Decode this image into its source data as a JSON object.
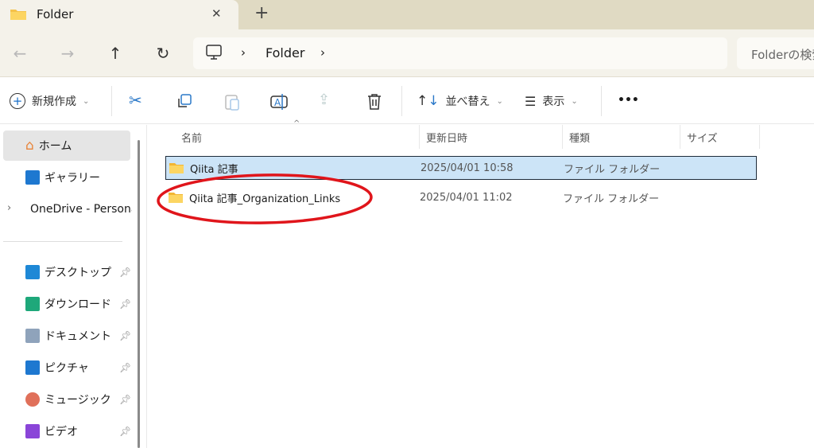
{
  "window": {
    "tab_title": "Folder",
    "new_tab": "+",
    "close": "✕"
  },
  "nav": {
    "back": "←",
    "forward": "→",
    "up": "↑",
    "refresh": "↻",
    "breadcrumb": [
      "Folder"
    ],
    "search_placeholder": "Folderの検索"
  },
  "toolbar": {
    "new": "新規作成",
    "sort": "並べ替え",
    "view": "表示",
    "more": "•••"
  },
  "sidebar": {
    "items": [
      {
        "label": "ホーム",
        "icon": "home-icon"
      },
      {
        "label": "ギャラリー",
        "icon": "gallery-icon"
      },
      {
        "label": "OneDrive - Personal",
        "icon": "onedrive-icon"
      }
    ],
    "pinned": [
      {
        "label": "デスクトップ",
        "icon": "desktop-icon",
        "color": "#1e88d6"
      },
      {
        "label": "ダウンロード",
        "icon": "download-icon",
        "color": "#1ea87a"
      },
      {
        "label": "ドキュメント",
        "icon": "document-icon",
        "color": "#8fa3bb"
      },
      {
        "label": "ピクチャ",
        "icon": "pictures-icon",
        "color": "#1e78d0"
      },
      {
        "label": "ミュージック",
        "icon": "music-icon",
        "color": "#e0705a"
      },
      {
        "label": "ビデオ",
        "icon": "video-icon",
        "color": "#8a45d8"
      }
    ]
  },
  "columns": [
    "名前",
    "更新日時",
    "種類",
    "サイズ"
  ],
  "files": [
    {
      "name": "Qiita 記事",
      "modified": "2025/04/01 10:58",
      "type": "ファイル フォルダー",
      "selected": true
    },
    {
      "name": "Qiita 記事_Organization_Links",
      "modified": "2025/04/01 11:02",
      "type": "ファイル フォルダー",
      "selected": false
    }
  ],
  "annotation": {
    "color": "#e0151b"
  }
}
